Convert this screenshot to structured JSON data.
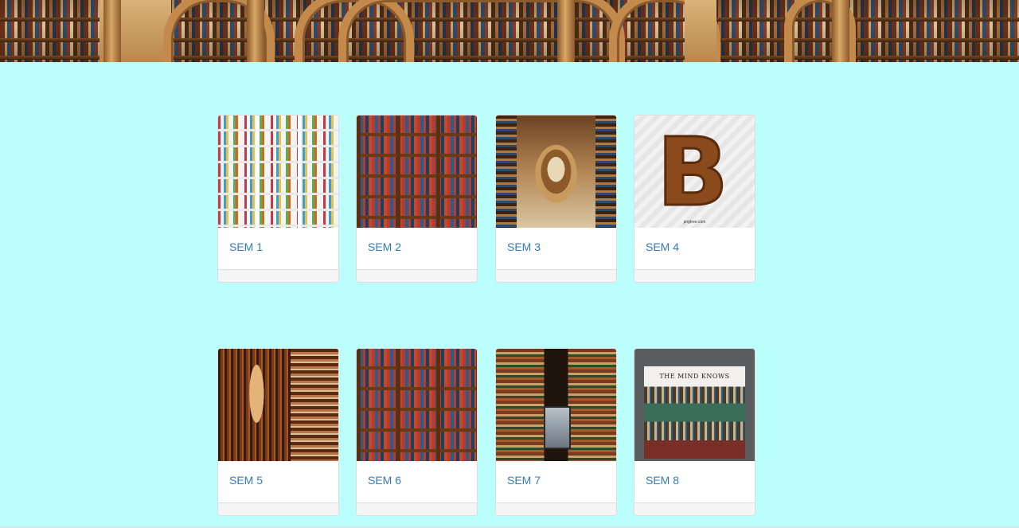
{
  "banner": {
    "image": "library-bookshelves-banner"
  },
  "cards": [
    {
      "title": "SEM 1",
      "image": "white-bookshelf"
    },
    {
      "title": "SEM 2",
      "image": "wooden-bookshelf"
    },
    {
      "title": "SEM 3",
      "image": "library-corridor-arches"
    },
    {
      "title": "SEM 4",
      "image": "letter-b-bookshelf",
      "watermark": "pngtree.com"
    },
    {
      "title": "SEM 5",
      "image": "long-library-hall"
    },
    {
      "title": "SEM 6",
      "image": "wooden-bookshelf"
    },
    {
      "title": "SEM 7",
      "image": "book-stacks-reader"
    },
    {
      "title": "SEM 8",
      "image": "the-mind-knows-library",
      "image_text": "THE MIND KNOWS"
    }
  ]
}
